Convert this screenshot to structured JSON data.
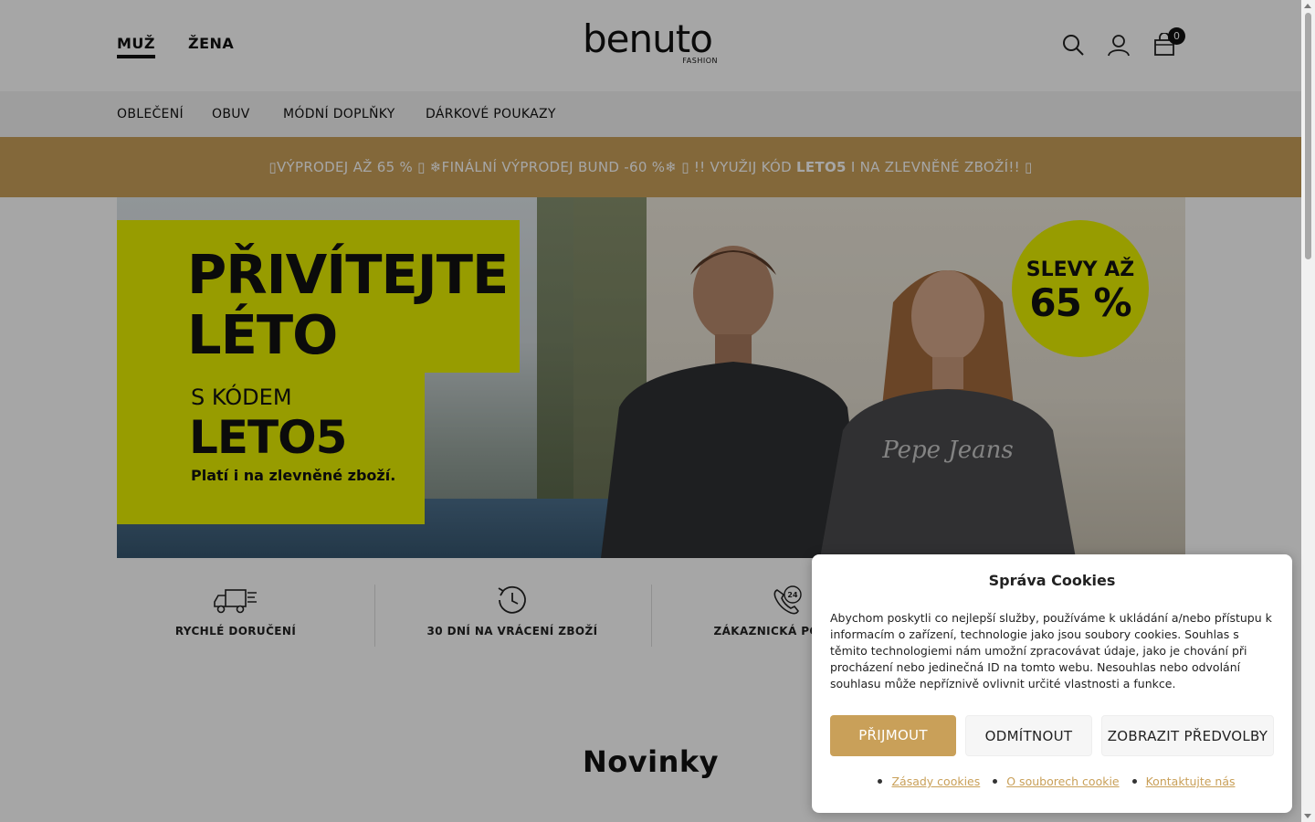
{
  "header": {
    "gender_tabs": [
      {
        "label": "MUŽ",
        "active": true
      },
      {
        "label": "ŽENA",
        "active": false
      }
    ],
    "logo": {
      "word": "benuto",
      "sub": "FASHION"
    },
    "icons": [
      "search-icon",
      "user-icon",
      "cart-icon"
    ],
    "cart_count": "0"
  },
  "categories": [
    "OBLEČENÍ",
    "OBUV",
    "MÓDNÍ DOPLŇKY",
    "DÁRKOVÉ POUKAZY"
  ],
  "promo": {
    "text_before": "▯VÝPRODEJ AŽ 65 % ▯ ❄FINÁLNÍ VÝPRODEJ BUND -60 %❄ ▯ !! VYUŽIJ KÓD ",
    "code": "LETO5",
    "text_after": " I NA ZLEVNĚNÉ ZBOŽÍ!! ▯",
    "color": "#c9a059"
  },
  "hero": {
    "title_line1": "PŘIVÍTEJTE",
    "title_line2": "LÉTO",
    "code_pre": "S KÓDEM",
    "code": "LETO5",
    "code_note": "Platí i na zlevněné zboží.",
    "badge_line1": "SLEVY AŽ",
    "badge_line2": "65 %",
    "accent": "#e8f000"
  },
  "features": [
    {
      "label": "RYCHLÉ DORUČENÍ",
      "icon": "truck-icon"
    },
    {
      "label": "30 DNÍ NA VRÁCENÍ ZBOŽÍ",
      "icon": "return-clock-icon"
    },
    {
      "label": "ZÁKAZNICKÁ PODPORA",
      "icon": "phone-24-icon"
    }
  ],
  "section_title": "Novinky",
  "cookie": {
    "title": "Správa Cookies",
    "text": "Abychom poskytli co nejlepší služby, používáme k ukládání a/nebo přístupu k informacím o zařízení, technologie jako jsou soubory cookies. Souhlas s těmito technologiemi nám umožní zpracovávat údaje, jako je chování při procházení nebo jedinečná ID na tomto webu. Nesouhlas nebo odvolání souhlasu může nepříznivě ovlivnit určité vlastnosti a funkce.",
    "accept_label": "PŘIJMOUT",
    "deny_label": "ODMÍTNOUT",
    "prefs_label": "ZOBRAZIT PŘEDVOLBY",
    "links": [
      "Zásady cookies",
      "O souborech cookie",
      "Kontaktujte nás"
    ],
    "accent": "#c9a059"
  }
}
